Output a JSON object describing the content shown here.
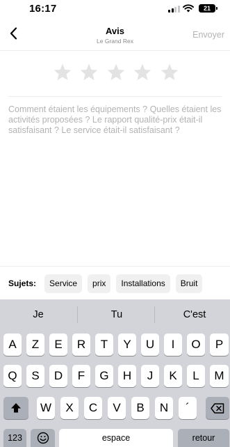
{
  "status_bar": {
    "time": "16:17",
    "battery": "21"
  },
  "nav": {
    "title": "Avis",
    "subtitle": "Le Grand Rex",
    "send_label": "Envoyer"
  },
  "rating": {
    "value": 0,
    "max": 5,
    "star_color": "#e3e3e3"
  },
  "review": {
    "placeholder": "Comment étaient les équipements ? Quelles étaient les activités proposées ? Le rapport qualité-prix était-il satisfaisant ? Le service était-il satisfaisant ?",
    "value": ""
  },
  "subjects": {
    "label": "Sujets:",
    "chips": [
      "Service",
      "prix",
      "Installations",
      "Bruit"
    ]
  },
  "keyboard": {
    "predictions": [
      "Je",
      "Tu",
      "C'est"
    ],
    "row1": [
      "A",
      "Z",
      "E",
      "R",
      "T",
      "Y",
      "U",
      "I",
      "O",
      "P"
    ],
    "row2": [
      "Q",
      "S",
      "D",
      "F",
      "G",
      "H",
      "J",
      "K",
      "L",
      "M"
    ],
    "row3": [
      "W",
      "X",
      "C",
      "V",
      "B",
      "N",
      "´"
    ],
    "numbers_label": "123",
    "space_label": "espace",
    "return_label": "retour"
  }
}
